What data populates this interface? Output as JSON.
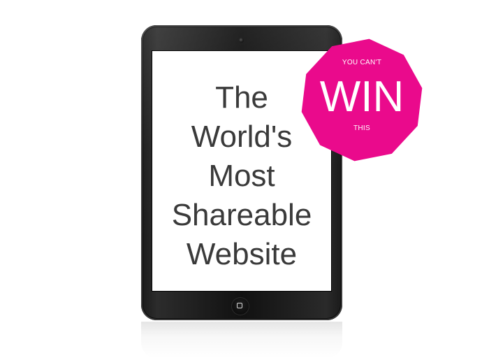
{
  "headline": {
    "line1": "The",
    "line2": "World's",
    "line3": "Most",
    "line4": "Shareable",
    "line5": "Website"
  },
  "badge": {
    "top": "YOU CAN'T",
    "main": "WIN",
    "bottom": "THIS",
    "color": "#ea0a8c"
  },
  "tablet": {
    "body_color": "#151515",
    "screen_color": "#ffffff"
  }
}
